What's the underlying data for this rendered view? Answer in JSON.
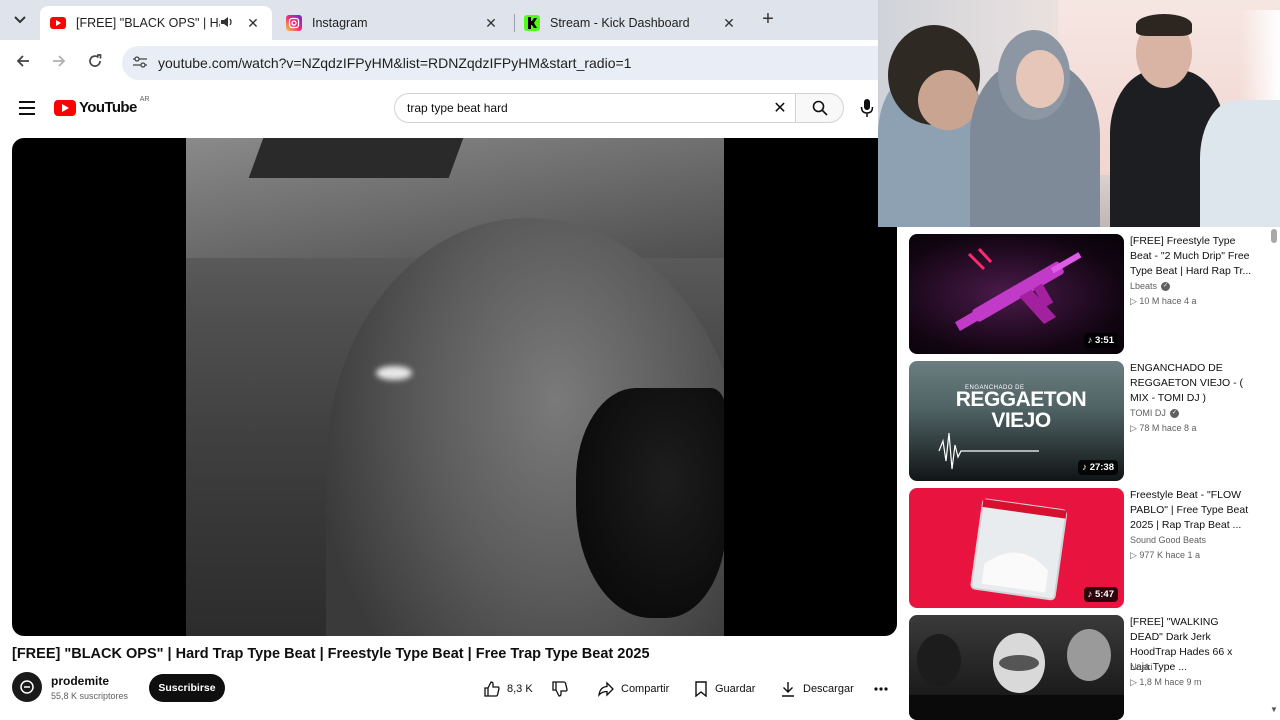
{
  "browser": {
    "tabs": [
      {
        "title": "[FREE] \"BLACK OPS\" | Hard Trap Type Beat",
        "favicon": "youtube-icon",
        "active": true,
        "audio": true
      },
      {
        "title": "Instagram",
        "favicon": "instagram-icon",
        "active": false
      },
      {
        "title": "Stream - Kick Dashboard",
        "favicon": "kick-icon",
        "active": false
      }
    ],
    "url": "youtube.com/watch?v=NZqdzIFPyHM&list=RDNZqdzIFPyHM&start_radio=1"
  },
  "youtube": {
    "logo_text": "YouTube",
    "country": "AR",
    "search_query": "trap type beat hard"
  },
  "video": {
    "title": "[FREE] \"BLACK OPS\" | Hard Trap Type Beat | Freestyle Type Beat | Free Trap Type Beat 2025",
    "channel": "prodemite",
    "subscribers": "55,8 K suscriptores",
    "subscribe_label": "Suscribirse",
    "likes": "8,3 K",
    "share_label": "Compartir",
    "save_label": "Guardar",
    "download_label": "Descargar"
  },
  "recommendations": [
    {
      "title": "[FREE] Freestyle Type Beat - \"2 Much Drip\" Free Type Beat | Hard Rap Tr...",
      "channel": "Lbeats",
      "verified": true,
      "stats": "10 M  hace 4 a",
      "duration": "3:51",
      "thumb_text": ""
    },
    {
      "title": "ENGANCHADO DE REGGAETON VIEJO - ( MIX - TOMI DJ )",
      "channel": "TOMI DJ",
      "verified": true,
      "stats": "78 M  hace 8 a",
      "duration": "27:38",
      "thumb_text": "REGGAETON VIEJO",
      "thumb_sub": "ENGANCHADO DE"
    },
    {
      "title": "Freestyle Beat - \"FLOW PABLO\" | Free Type Beat 2025 | Rap Trap Beat ...",
      "channel": "Sound Good Beats",
      "verified": false,
      "stats": "977 K  hace 1 a",
      "duration": "5:47",
      "thumb_text": ""
    },
    {
      "title": "[FREE] \"WALKING DEAD\" Dark Jerk HoodTrap Hades 66 x Laja Type ...",
      "channel": "Nuski",
      "verified": false,
      "stats": "1,8 M  hace 9 m",
      "duration": "",
      "thumb_text": ""
    }
  ],
  "colors": {
    "yt_red": "#ff0000",
    "kick_green": "#53fc18",
    "instagram_pink": "#e1306c"
  }
}
